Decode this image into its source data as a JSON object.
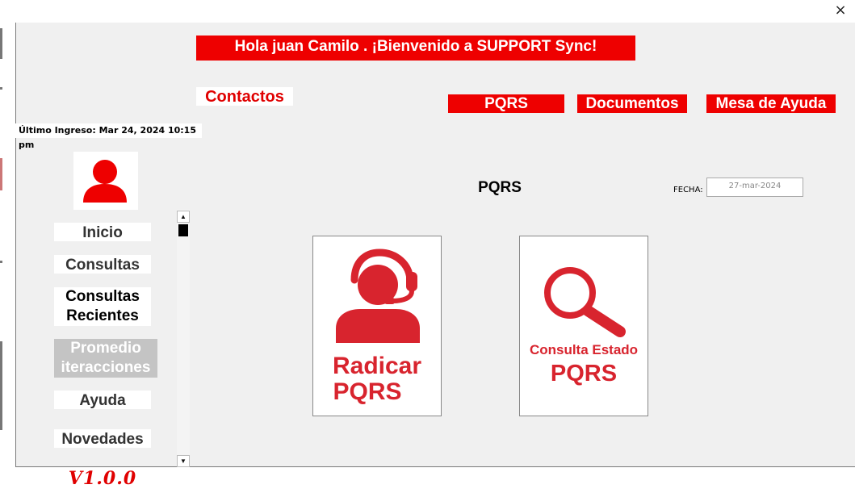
{
  "window": {
    "close_glyph": "×"
  },
  "header": {
    "greeting": "Hola juan Camilo . ¡Bienvenido a SUPPORT Sync!",
    "contacts_label": "Contactos",
    "nav": [
      {
        "label": "PQRS"
      },
      {
        "label": "Documentos"
      },
      {
        "label": "Mesa de Ayuda"
      }
    ]
  },
  "user": {
    "last_login": "Último Ingreso: Mar 24, 2024 10:15 pm",
    "avatar_icon": "user-icon"
  },
  "sidebar": {
    "items": [
      {
        "label": "Inicio"
      },
      {
        "label": "Consultas"
      },
      {
        "line1": "Consultas",
        "line2": "Recientes"
      },
      {
        "line1": "Promedio",
        "line2": "iteracciones",
        "disabled": true
      },
      {
        "label": "Ayuda"
      },
      {
        "label": "Novedades"
      }
    ],
    "version": "V1.0.0",
    "scroll": {
      "up": "▲",
      "down": "▼"
    }
  },
  "main": {
    "title": "PQRS",
    "date_label": "FECHA:",
    "date_value": "27-mar-2024",
    "cards": [
      {
        "icon": "headset-agent-icon",
        "line1": "Radicar",
        "line2": "PQRS"
      },
      {
        "icon": "magnifier-icon",
        "line1": "Consulta Estado",
        "line2": "PQRS"
      }
    ]
  },
  "colors": {
    "accent": "#ee0000",
    "card_text": "#d8242e",
    "disabled": "#c4c4c4"
  }
}
